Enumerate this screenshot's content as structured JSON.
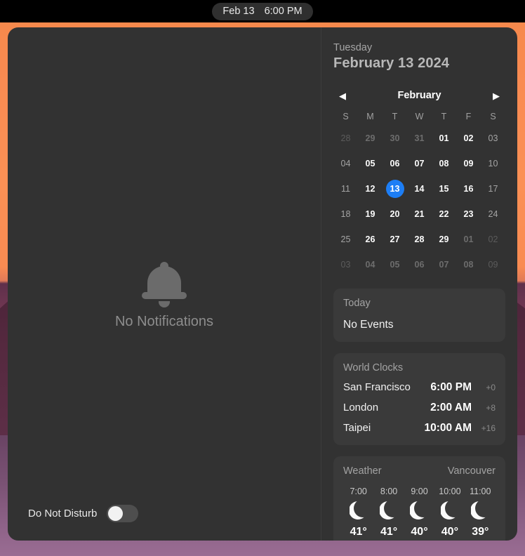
{
  "menubar": {
    "date": "Feb 13",
    "time": "6:00 PM"
  },
  "notifications": {
    "bell_icon": "bell-icon",
    "empty_label": "No Notifications",
    "dnd_label": "Do Not Disturb",
    "dnd_state": "off"
  },
  "date_header": {
    "weekday": "Tuesday",
    "full_date": "February 13 2024"
  },
  "calendar": {
    "prev_icon": "◀",
    "next_icon": "▶",
    "month": "February",
    "day_initials": [
      "S",
      "M",
      "T",
      "W",
      "T",
      "F",
      "S"
    ],
    "weeks": [
      [
        {
          "d": "28",
          "m": "other",
          "w": "weekend"
        },
        {
          "d": "29",
          "m": "other",
          "w": "weekday"
        },
        {
          "d": "30",
          "m": "other",
          "w": "weekday"
        },
        {
          "d": "31",
          "m": "other",
          "w": "weekday"
        },
        {
          "d": "01",
          "m": "cur",
          "w": "weekday"
        },
        {
          "d": "02",
          "m": "cur",
          "w": "weekday"
        },
        {
          "d": "03",
          "m": "cur",
          "w": "weekend"
        }
      ],
      [
        {
          "d": "04",
          "m": "cur",
          "w": "weekend"
        },
        {
          "d": "05",
          "m": "cur",
          "w": "weekday"
        },
        {
          "d": "06",
          "m": "cur",
          "w": "weekday"
        },
        {
          "d": "07",
          "m": "cur",
          "w": "weekday"
        },
        {
          "d": "08",
          "m": "cur",
          "w": "weekday"
        },
        {
          "d": "09",
          "m": "cur",
          "w": "weekday"
        },
        {
          "d": "10",
          "m": "cur",
          "w": "weekend"
        }
      ],
      [
        {
          "d": "11",
          "m": "cur",
          "w": "weekend"
        },
        {
          "d": "12",
          "m": "cur",
          "w": "weekday"
        },
        {
          "d": "13",
          "m": "cur",
          "w": "weekday",
          "today": true
        },
        {
          "d": "14",
          "m": "cur",
          "w": "weekday"
        },
        {
          "d": "15",
          "m": "cur",
          "w": "weekday"
        },
        {
          "d": "16",
          "m": "cur",
          "w": "weekday"
        },
        {
          "d": "17",
          "m": "cur",
          "w": "weekend"
        }
      ],
      [
        {
          "d": "18",
          "m": "cur",
          "w": "weekend"
        },
        {
          "d": "19",
          "m": "cur",
          "w": "weekday"
        },
        {
          "d": "20",
          "m": "cur",
          "w": "weekday"
        },
        {
          "d": "21",
          "m": "cur",
          "w": "weekday"
        },
        {
          "d": "22",
          "m": "cur",
          "w": "weekday"
        },
        {
          "d": "23",
          "m": "cur",
          "w": "weekday"
        },
        {
          "d": "24",
          "m": "cur",
          "w": "weekend"
        }
      ],
      [
        {
          "d": "25",
          "m": "cur",
          "w": "weekend"
        },
        {
          "d": "26",
          "m": "cur",
          "w": "weekday"
        },
        {
          "d": "27",
          "m": "cur",
          "w": "weekday"
        },
        {
          "d": "28",
          "m": "cur",
          "w": "weekday"
        },
        {
          "d": "29",
          "m": "cur",
          "w": "weekday"
        },
        {
          "d": "01",
          "m": "other",
          "w": "weekday"
        },
        {
          "d": "02",
          "m": "other",
          "w": "weekend"
        }
      ],
      [
        {
          "d": "03",
          "m": "other",
          "w": "weekend"
        },
        {
          "d": "04",
          "m": "other",
          "w": "weekday"
        },
        {
          "d": "05",
          "m": "other",
          "w": "weekday"
        },
        {
          "d": "06",
          "m": "other",
          "w": "weekday"
        },
        {
          "d": "07",
          "m": "other",
          "w": "weekday"
        },
        {
          "d": "08",
          "m": "other",
          "w": "weekday"
        },
        {
          "d": "09",
          "m": "other",
          "w": "weekend"
        }
      ]
    ],
    "selected_day": "13",
    "accent_color": "#1d7ef5"
  },
  "today_card": {
    "title": "Today",
    "events_text": "No Events"
  },
  "world_clocks": {
    "title": "World Clocks",
    "rows": [
      {
        "city": "San Francisco",
        "time": "6:00 PM",
        "offset": "+0"
      },
      {
        "city": "London",
        "time": "2:00 AM",
        "offset": "+8"
      },
      {
        "city": "Taipei",
        "time": "10:00 AM",
        "offset": "+16"
      }
    ]
  },
  "weather": {
    "title": "Weather",
    "location": "Vancouver",
    "hours": [
      {
        "label": "7:00",
        "icon": "crescent-moon-icon",
        "temp": "41°"
      },
      {
        "label": "8:00",
        "icon": "crescent-moon-icon",
        "temp": "41°"
      },
      {
        "label": "9:00",
        "icon": "crescent-moon-icon",
        "temp": "40°"
      },
      {
        "label": "10:00",
        "icon": "crescent-moon-icon",
        "temp": "40°"
      },
      {
        "label": "11:00",
        "icon": "crescent-moon-icon",
        "temp": "39°"
      }
    ]
  }
}
